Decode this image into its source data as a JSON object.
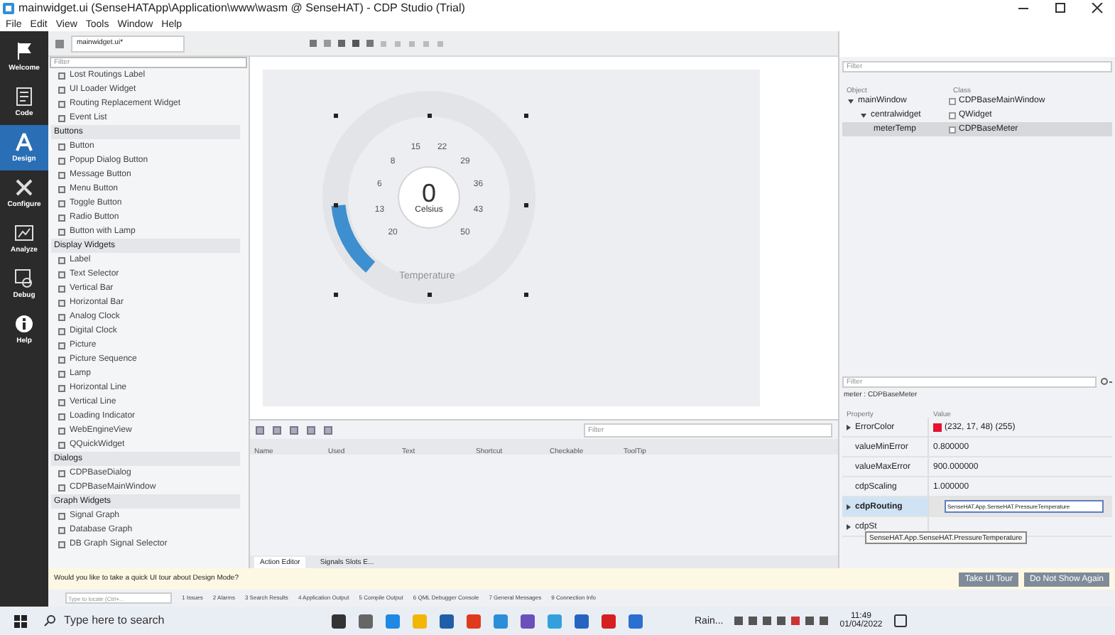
{
  "window": {
    "title": "mainwidget.ui (SenseHATApp\\Application\\www\\wasm @ SenseHAT) - CDP Studio (Trial)"
  },
  "menu": [
    "File",
    "Edit",
    "View",
    "Tools",
    "Window",
    "Help"
  ],
  "modes": [
    {
      "label": "Welcome",
      "kind": "flag",
      "selected": false
    },
    {
      "label": "Code",
      "kind": "doc",
      "selected": false
    },
    {
      "label": "Design",
      "kind": "design",
      "selected": true
    },
    {
      "label": "Configure",
      "kind": "tools",
      "selected": false
    },
    {
      "label": "Analyze",
      "kind": "chart",
      "selected": false
    },
    {
      "label": "Debug",
      "kind": "debug",
      "selected": false
    },
    {
      "label": "Help",
      "kind": "info",
      "selected": false
    }
  ],
  "editor_tab": {
    "label": "mainwidget.ui*"
  },
  "palette": {
    "filter_placeholder": "Filter",
    "groups": [
      {
        "items": [
          "Lost Routings Label",
          "UI Loader Widget",
          "Routing Replacement Widget",
          "Event List"
        ]
      },
      {
        "label": "Buttons",
        "items": [
          "Button",
          "Popup Dialog Button",
          "Message Button",
          "Menu Button",
          "Toggle Button",
          "Radio Button",
          "Button with Lamp"
        ]
      },
      {
        "label": "Display Widgets",
        "items": [
          "Label",
          "Text Selector",
          "Vertical Bar",
          "Horizontal Bar",
          "Analog Clock",
          "Digital Clock",
          "Picture",
          "Picture Sequence",
          "Lamp",
          "Horizontal Line",
          "Vertical Line",
          "Loading Indicator",
          "WebEngineView",
          "QQuickWidget"
        ]
      },
      {
        "label": "Dialogs",
        "items": [
          "CDPBaseDialog",
          "CDPBaseMainWindow"
        ]
      },
      {
        "label": "Graph Widgets",
        "items": [
          "Signal Graph",
          "Database Graph",
          "DB Graph Signal Selector"
        ]
      }
    ]
  },
  "gauge": {
    "ticks": [
      "20",
      "13",
      "6",
      "8",
      "15",
      "22",
      "29",
      "36",
      "43",
      "50"
    ],
    "value": "0",
    "unit": "Celsius",
    "title": "Temperature"
  },
  "action_editor": {
    "filter_placeholder": "Filter",
    "columns": [
      "Name",
      "Used",
      "Text",
      "Shortcut",
      "Checkable",
      "ToolTip"
    ],
    "tabs": [
      {
        "label": "Action Editor",
        "selected": true
      },
      {
        "label": "Signals Slots E...",
        "selected": false
      }
    ]
  },
  "object_inspector": {
    "filter_placeholder": "Filter",
    "columns": [
      "Object",
      "Class"
    ],
    "tree": [
      {
        "object": "mainWindow",
        "class": "CDPBaseMainWindow",
        "expanded": true,
        "selected": false,
        "children": [
          {
            "object": "centralwidget",
            "class": "QWidget",
            "expanded": true,
            "selected": false,
            "children": [
              {
                "object": "meterTemp",
                "class": "CDPBaseMeter",
                "selected": true
              }
            ]
          }
        ]
      }
    ]
  },
  "property_editor": {
    "filter_placeholder": "Filter",
    "object_label": "meter : CDPBaseMeter",
    "columns": [
      "Property",
      "Value"
    ],
    "rows": [
      {
        "name": "ErrorColor",
        "kind": "color",
        "value": "(232, 17, 48) (255)",
        "color": "#e81130",
        "expandable": true,
        "bold": false
      },
      {
        "name": "valueMinError",
        "kind": "text",
        "value": "0.800000",
        "expandable": false,
        "bold": false
      },
      {
        "name": "valueMaxError",
        "kind": "text",
        "value": "900.000000",
        "expandable": false,
        "bold": false
      },
      {
        "name": "cdpScaling",
        "kind": "text",
        "value": "1.000000",
        "expandable": false,
        "bold": false
      },
      {
        "name": "cdpRouting",
        "kind": "edit",
        "value": "SenseHAT.App.SenseHAT.PressureTemperature",
        "expandable": true,
        "bold": true
      },
      {
        "name": "cdpSt",
        "kind": "text",
        "expandable": true,
        "bold": false
      }
    ],
    "tooltip": "SenseHAT.App.SenseHAT.PressureTemperature"
  },
  "tour_bar": {
    "message": "Would you like to take a quick UI tour about Design Mode?",
    "buttons": [
      "Take UI Tour",
      "Do Not Show Again"
    ]
  },
  "output_bar": {
    "locate_placeholder": "Type to locate (Ctrl+...",
    "tabs": [
      "1 Issues",
      "2 Alarms",
      "3 Search Results",
      "4 Application Output",
      "5 Compile Output",
      "6 QML Debugger Console",
      "7 General Messages",
      "9 Connection Info"
    ]
  },
  "taskbar": {
    "search_placeholder": "Type here to search",
    "weather": "Rain...",
    "time": "11:49",
    "date": "01/04/2022"
  }
}
